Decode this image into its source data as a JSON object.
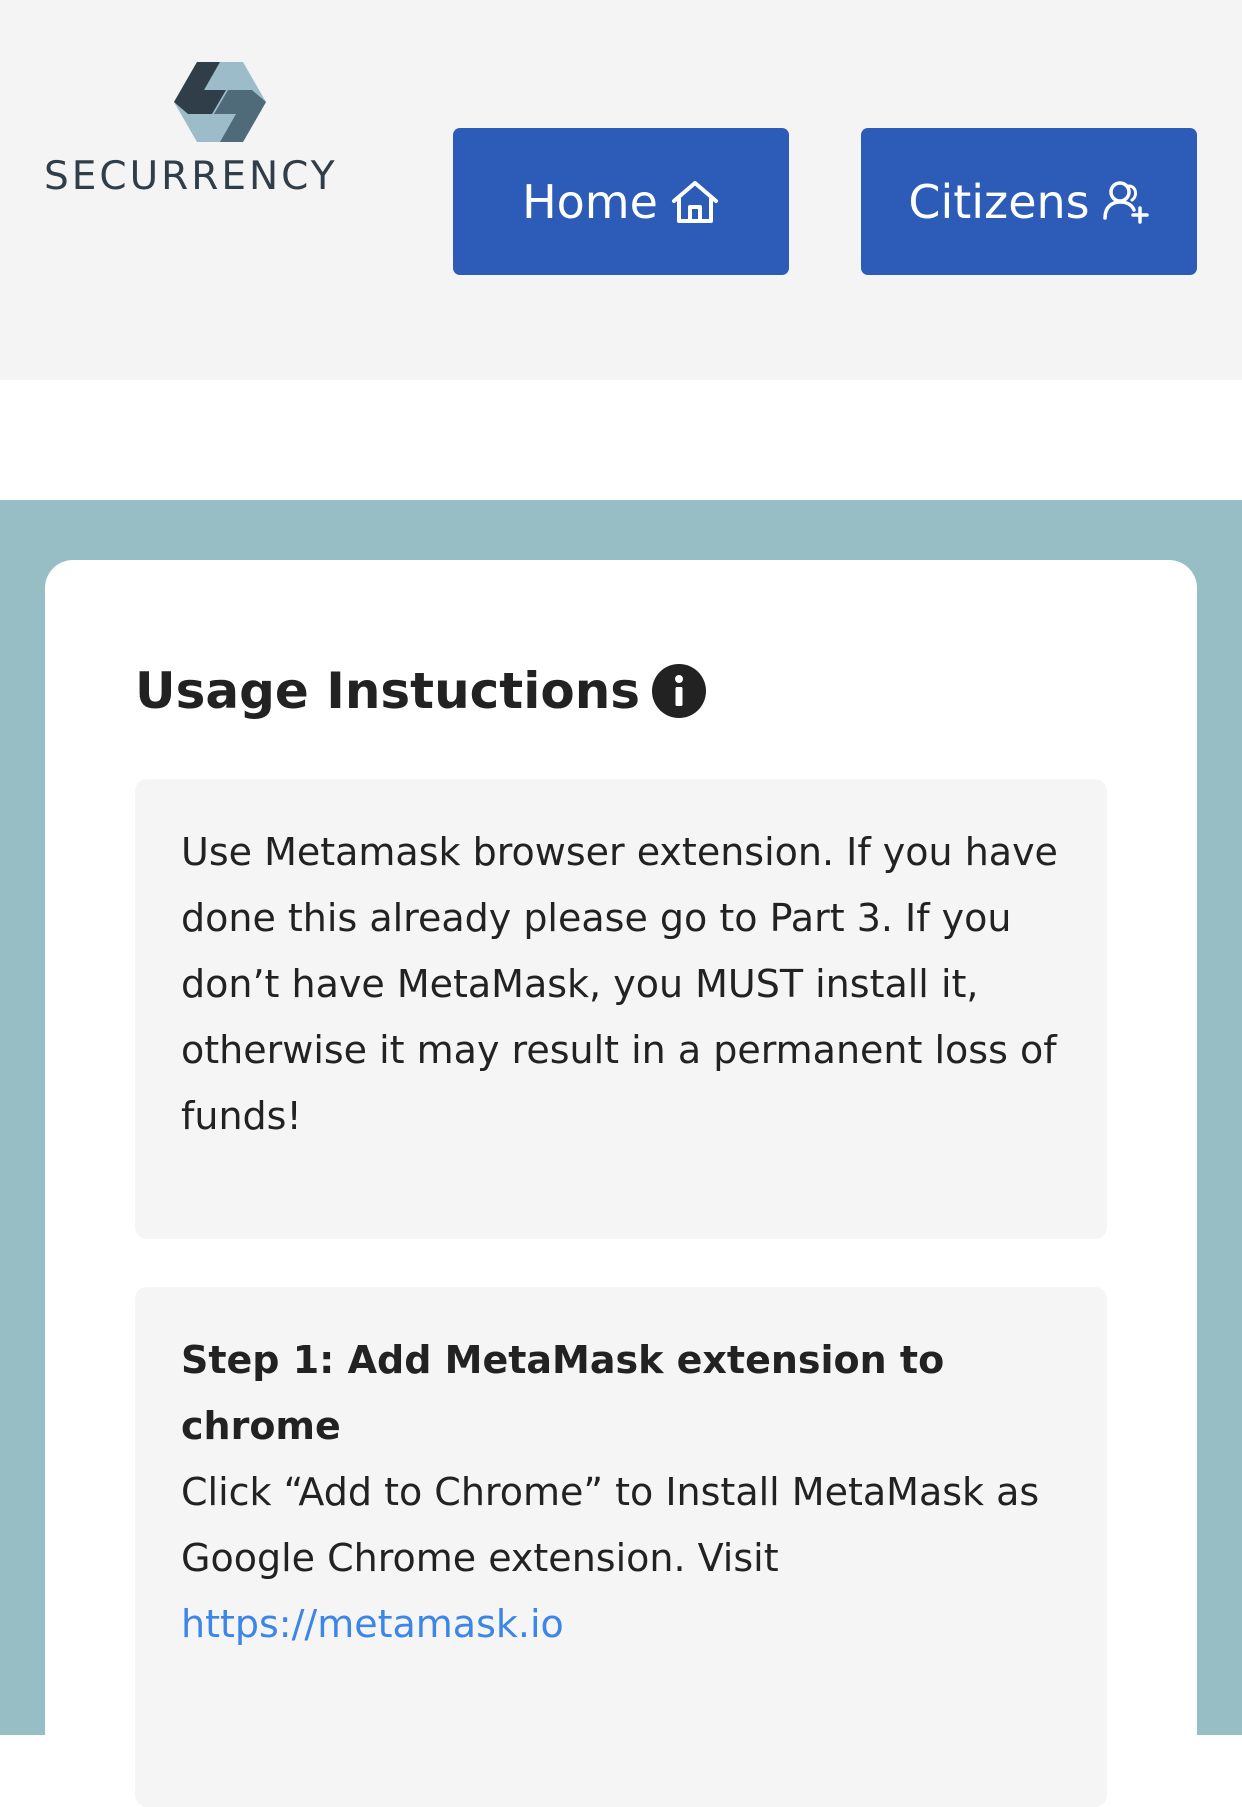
{
  "brand": {
    "name": "SECURRENCY"
  },
  "nav": {
    "home_label": "Home",
    "citizens_label": "Citizens",
    "home_icon": "home-icon",
    "citizens_icon": "add-user-icon"
  },
  "colors": {
    "header_bg": "#f4f4f4",
    "button_bg": "#2d5bb8",
    "section_bg": "#97bec5",
    "link": "#3b86e6"
  },
  "instructions": {
    "title": "Usage Instuctions",
    "info_icon": "info-icon",
    "intro": "Use Metamask browser extension. If you have done this already please go to Part 3. If you don’t have MetaMask, you MUST install it, otherwise it may result in a permanent loss of funds!",
    "step1": {
      "title": "Step 1: Add MetaMask extension to chrome",
      "body": "Click “Add to Chrome” to Install MetaMask as Google Chrome extension. Visit",
      "link": "https://metamask.io"
    }
  }
}
